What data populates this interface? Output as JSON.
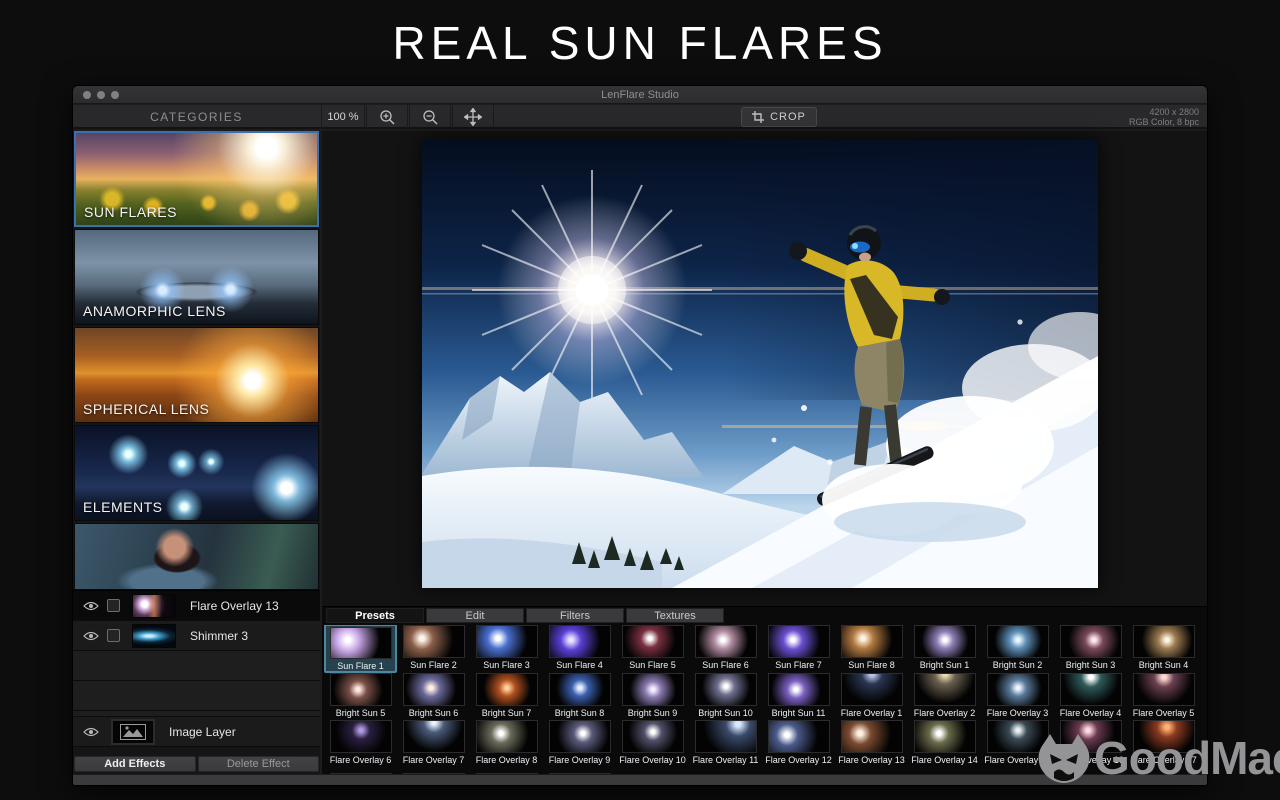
{
  "page": {
    "headline": "REAL SUN FLARES",
    "watermark": "GoodMac"
  },
  "colors": {
    "category_selection_blue": "#3c6fb0",
    "preset_selection_teal": "#4f87a0",
    "watermark_gray": "#949496",
    "headline_white": "#ffffff"
  },
  "icons": {
    "zoom_in": "magnifier-plus-icon",
    "zoom_out": "magnifier-minus-icon",
    "pan": "move-arrows-icon",
    "crop": "crop-frame-icon",
    "layer_visibility": "eye-icon",
    "image_layer": "landscape-photo-icon",
    "watermark_logo": "goodmac-devil-face-icon"
  },
  "window": {
    "title": "LenFlare Studio",
    "toolbar": {
      "zoom_level": "100 %",
      "crop_label": "CROP",
      "doc_size": "4200 x 2800",
      "doc_color": "RGB Color, 8 bpc"
    },
    "sidebar": {
      "header": "CATEGORIES",
      "categories": [
        {
          "label": "SUN FLARES",
          "selected": true
        },
        {
          "label": "ANAMORPHIC LENS",
          "selected": false
        },
        {
          "label": "SPHERICAL LENS",
          "selected": false
        },
        {
          "label": "ELEMENTS",
          "selected": false
        },
        {
          "label": "",
          "selected": false
        }
      ],
      "layers": [
        {
          "name": "Flare Overlay 13",
          "style": "flare13",
          "selected": true
        },
        {
          "name": "Shimmer 3",
          "style": "shimmer3",
          "selected": false
        }
      ],
      "image_layer_label": "Image Layer",
      "add_button": "Add Effects",
      "delete_button": "Delete Effect"
    },
    "bottom_panel": {
      "tabs": [
        {
          "label": "Presets",
          "selected": true
        },
        {
          "label": "Edit",
          "selected": false
        },
        {
          "label": "Filters",
          "selected": false
        },
        {
          "label": "Textures",
          "selected": false
        }
      ],
      "presets": [
        {
          "name": "Sun Flare 1",
          "color": "#ffffff",
          "accent": "#c9a7e8",
          "px": "28%",
          "py": "40%",
          "selected": true
        },
        {
          "name": "Sun Flare 2",
          "color": "#fff4e8",
          "accent": "#8a5f4a",
          "px": "30%",
          "py": "40%",
          "selected": false
        },
        {
          "name": "Sun Flare 3",
          "color": "#ffffff",
          "accent": "#4a6fd0",
          "px": "35%",
          "py": "40%",
          "selected": false
        },
        {
          "name": "Sun Flare 4",
          "color": "#e8e2ff",
          "accent": "#5b3fd6",
          "px": "35%",
          "py": "45%",
          "selected": false
        },
        {
          "name": "Sun Flare 5",
          "color": "#ffffff",
          "accent": "#7a3040",
          "px": "45%",
          "py": "40%",
          "selected": false
        },
        {
          "name": "Sun Flare 6",
          "color": "#ffffff",
          "accent": "#b08aa0",
          "px": "45%",
          "py": "45%",
          "selected": false
        },
        {
          "name": "Sun Flare 7",
          "color": "#ffffff",
          "accent": "#6a4fd0",
          "px": "40%",
          "py": "45%",
          "selected": false
        },
        {
          "name": "Sun Flare 8",
          "color": "#fff0dc",
          "accent": "#b07840",
          "px": "35%",
          "py": "40%",
          "selected": false
        },
        {
          "name": "Bright Sun 1",
          "color": "#ffffff",
          "accent": "#8f7fb8",
          "px": "50%",
          "py": "45%",
          "selected": false
        },
        {
          "name": "Bright Sun 2",
          "color": "#eaf6ff",
          "accent": "#5f8fb8",
          "px": "50%",
          "py": "45%",
          "selected": false
        },
        {
          "name": "Bright Sun 3",
          "color": "#ffe8f0",
          "accent": "#7a4a5a",
          "px": "55%",
          "py": "45%",
          "selected": false
        },
        {
          "name": "Bright Sun 4",
          "color": "#fff4e0",
          "accent": "#9a7a50",
          "px": "55%",
          "py": "45%",
          "selected": false
        },
        {
          "name": "Bright Sun 5",
          "color": "#ffe8e0",
          "accent": "#7a5048",
          "px": "45%",
          "py": "50%",
          "selected": false
        },
        {
          "name": "Bright Sun 6",
          "color": "#fff0e0",
          "accent": "#6a6a9a",
          "px": "45%",
          "py": "45%",
          "selected": false
        },
        {
          "name": "Bright Sun 7",
          "color": "#ffcf9a",
          "accent": "#b05020",
          "px": "50%",
          "py": "45%",
          "selected": false
        },
        {
          "name": "Bright Sun 8",
          "color": "#e8f0ff",
          "accent": "#3a5fae",
          "px": "50%",
          "py": "45%",
          "selected": false
        },
        {
          "name": "Bright Sun 9",
          "color": "#f4f0ff",
          "accent": "#8a7ab0",
          "px": "50%",
          "py": "50%",
          "selected": false
        },
        {
          "name": "Bright Sun 10",
          "color": "#ffffff",
          "accent": "#6f6f8f",
          "px": "50%",
          "py": "40%",
          "selected": false
        },
        {
          "name": "Bright Sun 11",
          "color": "#ffffff",
          "accent": "#7a5fc0",
          "px": "45%",
          "py": "50%",
          "selected": false
        },
        {
          "name": "Flare Overlay 1",
          "color": "#b8c4e8",
          "accent": "#2a3550",
          "px": "50%",
          "py": "0%",
          "selected": false
        },
        {
          "name": "Flare Overlay 2",
          "color": "#e8d9b0",
          "accent": "#6a6050",
          "px": "50%",
          "py": "0%",
          "selected": false
        },
        {
          "name": "Flare Overlay 3",
          "color": "#eef4ff",
          "accent": "#5a7a9a",
          "px": "50%",
          "py": "45%",
          "selected": false
        },
        {
          "name": "Flare Overlay 4",
          "color": "#ffffff",
          "accent": "#2f5a5a",
          "px": "50%",
          "py": "10%",
          "selected": false
        },
        {
          "name": "Flare Overlay 5",
          "color": "#ffd9d0",
          "accent": "#6a4050",
          "px": "50%",
          "py": "10%",
          "selected": false
        },
        {
          "name": "Flare Overlay 6",
          "color": "#b09ae0",
          "accent": "#2a2040",
          "px": "50%",
          "py": "30%",
          "selected": false
        },
        {
          "name": "Flare Overlay 7",
          "color": "#e8f0ff",
          "accent": "#4a5a78",
          "px": "50%",
          "py": "5%",
          "selected": false
        },
        {
          "name": "Flare Overlay 8",
          "color": "#ffffff",
          "accent": "#6a6a5a",
          "px": "40%",
          "py": "40%",
          "selected": false
        },
        {
          "name": "Flare Overlay 9",
          "color": "#ffffff",
          "accent": "#5a5a7a",
          "px": "55%",
          "py": "40%",
          "selected": false
        },
        {
          "name": "Flare Overlay 10",
          "color": "#ffffff",
          "accent": "#50506a",
          "px": "50%",
          "py": "35%",
          "selected": false
        },
        {
          "name": "Flare Overlay 11",
          "color": "#d8e8ff",
          "accent": "#3a4a6a",
          "px": "70%",
          "py": "10%",
          "selected": false
        },
        {
          "name": "Flare Overlay 12",
          "color": "#ffffff",
          "accent": "#4a5a8a",
          "px": "30%",
          "py": "45%",
          "selected": false
        },
        {
          "name": "Flare Overlay 13",
          "color": "#fff0e0",
          "accent": "#7a4a30",
          "px": "30%",
          "py": "40%",
          "selected": false
        },
        {
          "name": "Flare Overlay 14",
          "color": "#ffffff",
          "accent": "#6a6a4a",
          "px": "40%",
          "py": "40%",
          "selected": false
        },
        {
          "name": "Flare Overlay 15",
          "color": "#e8f0f4",
          "accent": "#3a4a55",
          "px": "50%",
          "py": "30%",
          "selected": false
        },
        {
          "name": "Flare Overlay 16",
          "color": "#ffd9e0",
          "accent": "#6a3a50",
          "px": "45%",
          "py": "30%",
          "selected": false
        },
        {
          "name": "Flare Overlay 17",
          "color": "#ffb070",
          "accent": "#8a3a20",
          "px": "55%",
          "py": "20%",
          "selected": false
        }
      ],
      "partial_presets": [
        {
          "color": "#9a4048",
          "accent": "#40181c"
        },
        {
          "color": "#e8ecf2",
          "accent": "#4a4a52"
        },
        {
          "color": "#ffffff",
          "accent": "#5a5a66"
        },
        {
          "color": "#9a8ad0",
          "accent": "#342a50"
        }
      ]
    }
  }
}
